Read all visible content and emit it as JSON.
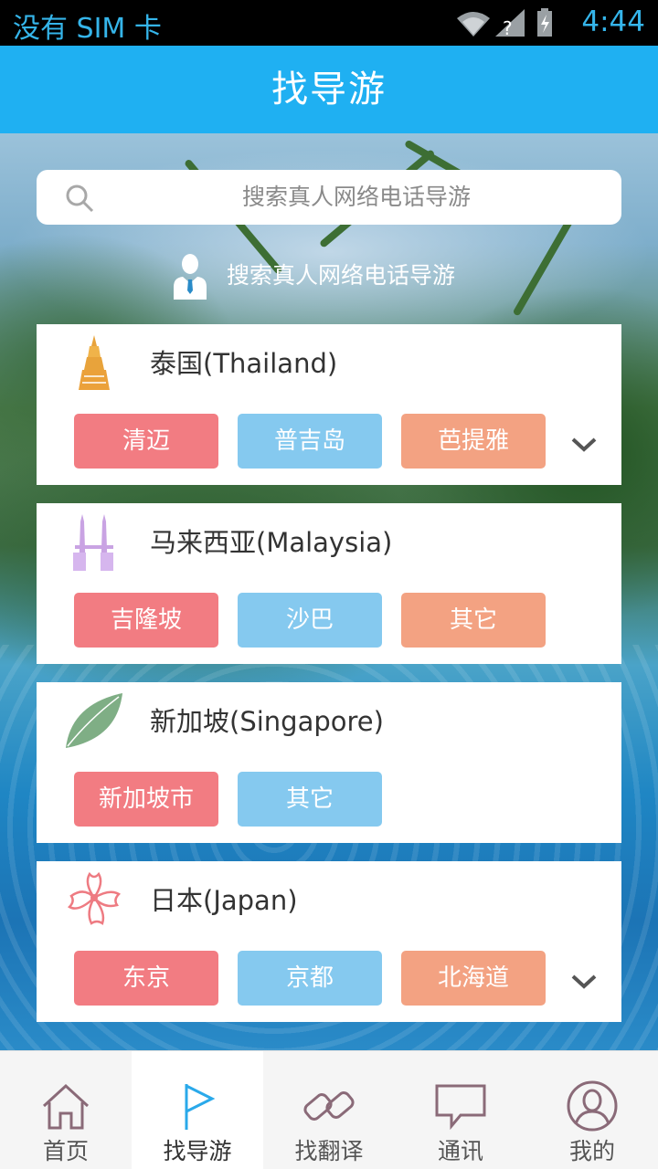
{
  "status_bar": {
    "carrier": "没有 SIM 卡",
    "time": "4:44"
  },
  "header": {
    "title": "找导游"
  },
  "search": {
    "placeholder": "搜索真人网络电话导游"
  },
  "guide_link": {
    "label": "搜索真人网络电话导游"
  },
  "countries": [
    {
      "name": "泰国(Thailand)",
      "icon": "pagoda-icon",
      "cities": [
        "清迈",
        "普吉岛",
        "芭提雅"
      ],
      "expandable": true
    },
    {
      "name": "马来西亚(Malaysia)",
      "icon": "twin-towers-icon",
      "cities": [
        "吉隆坡",
        "沙巴",
        "其它"
      ],
      "expandable": false
    },
    {
      "name": "新加坡(Singapore)",
      "icon": "leaf-icon",
      "cities": [
        "新加坡市",
        "其它"
      ],
      "expandable": false
    },
    {
      "name": "日本(Japan)",
      "icon": "cherry-blossom-icon",
      "cities": [
        "东京",
        "京都",
        "北海道"
      ],
      "expandable": true
    }
  ],
  "tabs": [
    {
      "label": "首页",
      "icon": "home-icon"
    },
    {
      "label": "找导游",
      "icon": "flag-icon",
      "active": true
    },
    {
      "label": "找翻译",
      "icon": "link-icon"
    },
    {
      "label": "通讯",
      "icon": "chat-bubble-icon"
    },
    {
      "label": "我的",
      "icon": "user-icon"
    }
  ],
  "colors": {
    "header": "#1fb0f2",
    "tag_red": "#f27c82",
    "tag_blue": "#85c9ef",
    "tag_orange": "#f3a282",
    "status_text": "#35b5ea"
  }
}
